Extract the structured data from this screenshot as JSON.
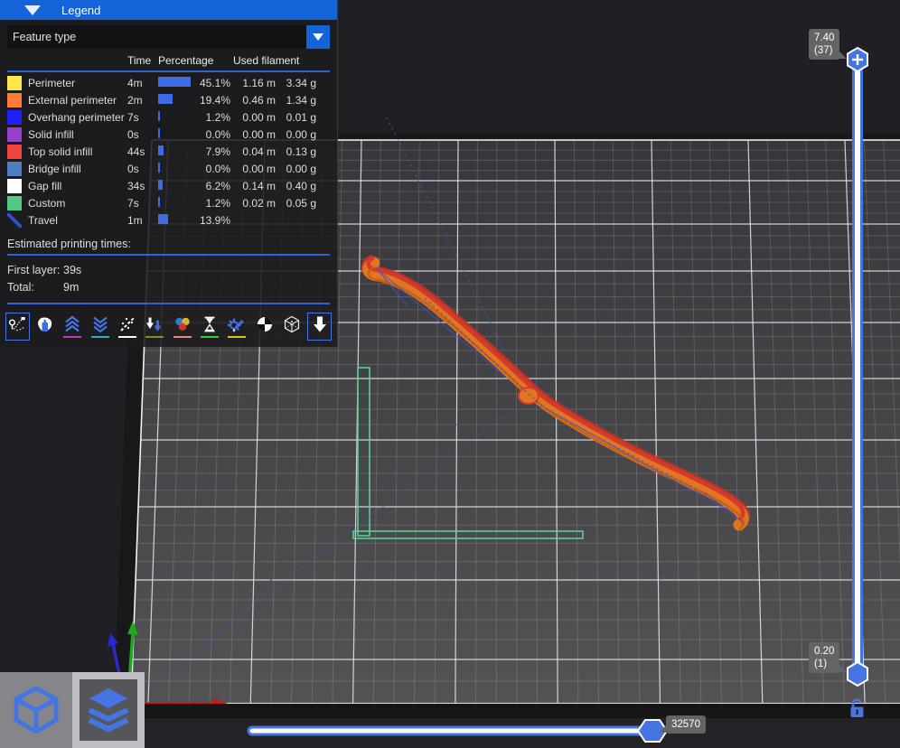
{
  "colors": {
    "accent": "#4575E3",
    "header_blue": "#1463D8",
    "bar_blue": "#3D6BE8"
  },
  "legend": {
    "title": "Legend",
    "view_type": "Feature type",
    "columns": {
      "time": "Time",
      "percentage": "Percentage",
      "used_filament": "Used filament"
    },
    "rows": [
      {
        "label": "Perimeter",
        "color": "#FFE64D",
        "time": "4m",
        "percent": "45.1%",
        "pct": 45.1,
        "filament_m": "1.16 m",
        "filament_g": "3.34 g"
      },
      {
        "label": "External perimeter",
        "color": "#FF7D38",
        "time": "2m",
        "percent": "19.4%",
        "pct": 19.4,
        "filament_m": "0.46 m",
        "filament_g": "1.34 g"
      },
      {
        "label": "Overhang perimeter",
        "color": "#1F1FFF",
        "time": "7s",
        "percent": "1.2%",
        "pct": 1.2,
        "filament_m": "0.00 m",
        "filament_g": "0.01 g"
      },
      {
        "label": "Solid infill",
        "color": "#9641CB",
        "time": "0s",
        "percent": "0.0%",
        "pct": 0.0,
        "filament_m": "0.00 m",
        "filament_g": "0.00 g"
      },
      {
        "label": "Top solid infill",
        "color": "#F04540",
        "time": "44s",
        "percent": "7.9%",
        "pct": 7.9,
        "filament_m": "0.04 m",
        "filament_g": "0.13 g"
      },
      {
        "label": "Bridge infill",
        "color": "#4D80BF",
        "time": "0s",
        "percent": "0.0%",
        "pct": 0.0,
        "filament_m": "0.00 m",
        "filament_g": "0.00 g"
      },
      {
        "label": "Gap fill",
        "color": "#FFFFFF",
        "time": "34s",
        "percent": "6.2%",
        "pct": 6.2,
        "filament_m": "0.14 m",
        "filament_g": "0.40 g"
      },
      {
        "label": "Custom",
        "color": "#52C882",
        "time": "7s",
        "percent": "1.2%",
        "pct": 1.2,
        "filament_m": "0.02 m",
        "filament_g": "0.05 g"
      },
      {
        "label": "Travel",
        "color": "#3050C8",
        "travel_line": true,
        "time": "1m",
        "percent": "13.9%",
        "pct": 13.9,
        "filament_m": "",
        "filament_g": ""
      }
    ],
    "estimated_title": "Estimated printing times:",
    "first_layer_label": "First layer:",
    "first_layer_value": "39s",
    "total_label": "Total:",
    "total_value": "9m",
    "toolbar": [
      {
        "name": "travel-paths",
        "underline": null,
        "selected": true
      },
      {
        "name": "wipe",
        "underline": null,
        "selected": false
      },
      {
        "name": "retractions",
        "underline": "#C832C8",
        "selected": false
      },
      {
        "name": "deretractions",
        "underline": "#2AB5B5",
        "selected": false
      },
      {
        "name": "seams",
        "underline": "#FFFFFF",
        "selected": false
      },
      {
        "name": "tool-changes",
        "underline": "#8C8C25",
        "selected": false
      },
      {
        "name": "color-changes",
        "underline": "#EE8A7C",
        "selected": false
      },
      {
        "name": "pause-prints",
        "underline": "#33CC33",
        "selected": false
      },
      {
        "name": "custom-gcodes",
        "underline": "#D4C328",
        "selected": false
      },
      {
        "name": "center-of-gravity",
        "underline": null,
        "selected": false
      },
      {
        "name": "shells",
        "underline": null,
        "selected": false
      },
      {
        "name": "tool-marker",
        "underline": null,
        "selected": true
      }
    ]
  },
  "layer_slider": {
    "top_value": "7.40",
    "top_layer": "(37)",
    "bottom_value": "0.20",
    "bottom_layer": "(1)"
  },
  "move_slider": {
    "value": "32570"
  }
}
